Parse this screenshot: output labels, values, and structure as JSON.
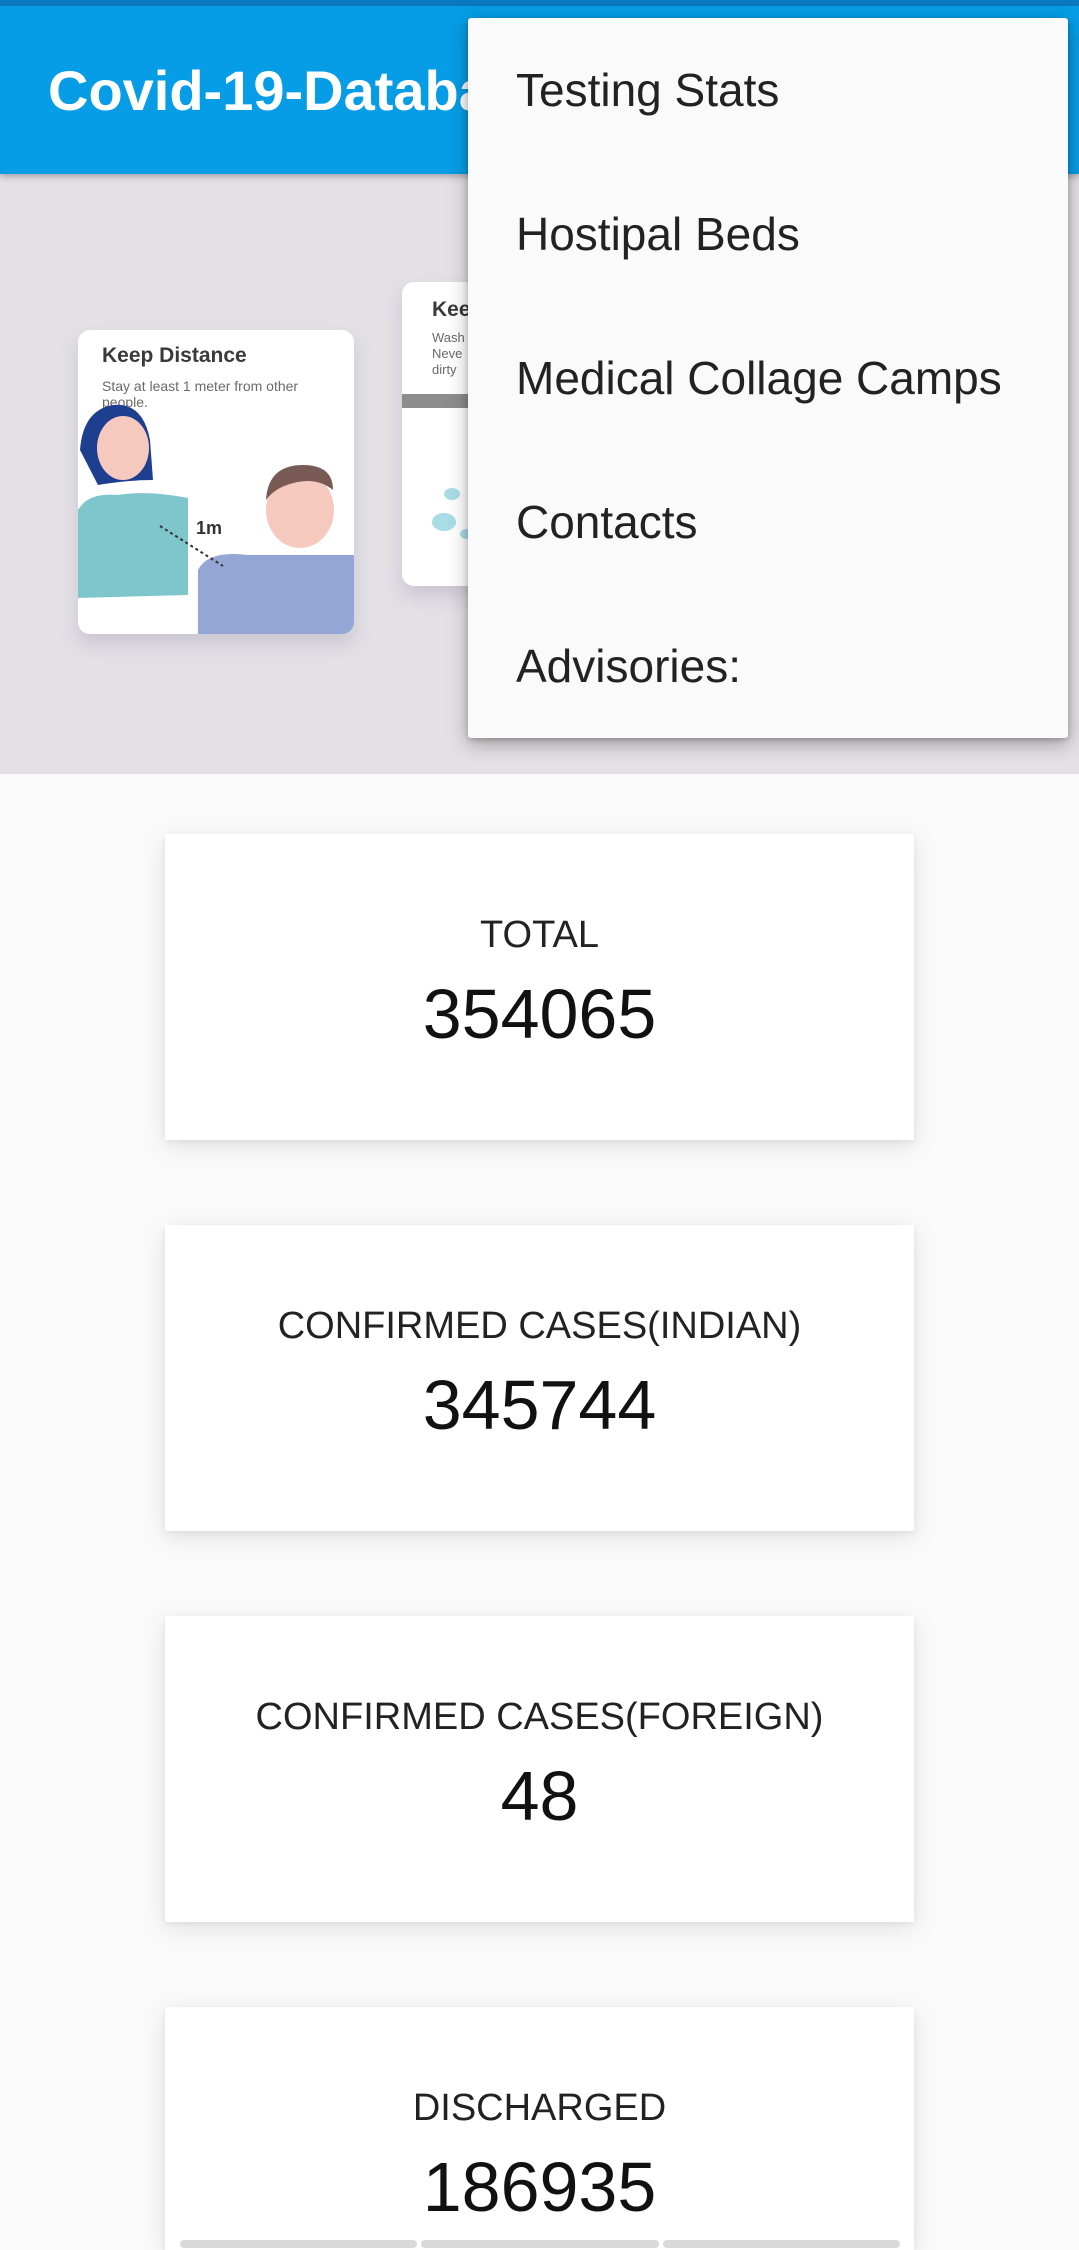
{
  "app": {
    "title": "Covid-19-Database"
  },
  "menu": {
    "items": [
      {
        "label": "Testing Stats"
      },
      {
        "label": "Hostipal Beds"
      },
      {
        "label": "Medical Collage Camps"
      },
      {
        "label": "Contacts"
      },
      {
        "label": "Advisories:"
      }
    ]
  },
  "hero": {
    "card1": {
      "title": "Keep Distance",
      "text": "Stay at least 1 meter from other people.",
      "distance": "1m"
    },
    "card2": {
      "title": "Kee",
      "text": "Wash Neve dirty"
    }
  },
  "stats": [
    {
      "label": "TOTAL",
      "value": "354065"
    },
    {
      "label": "CONFIRMED CASES(INDIAN)",
      "value": "345744"
    },
    {
      "label": "CONFIRMED CASES(FOREIGN)",
      "value": "48"
    },
    {
      "label": "DISCHARGED",
      "value": "186935"
    }
  ],
  "colors": {
    "appbar": "#069de6",
    "hero_bg": "#e3e1e5"
  }
}
